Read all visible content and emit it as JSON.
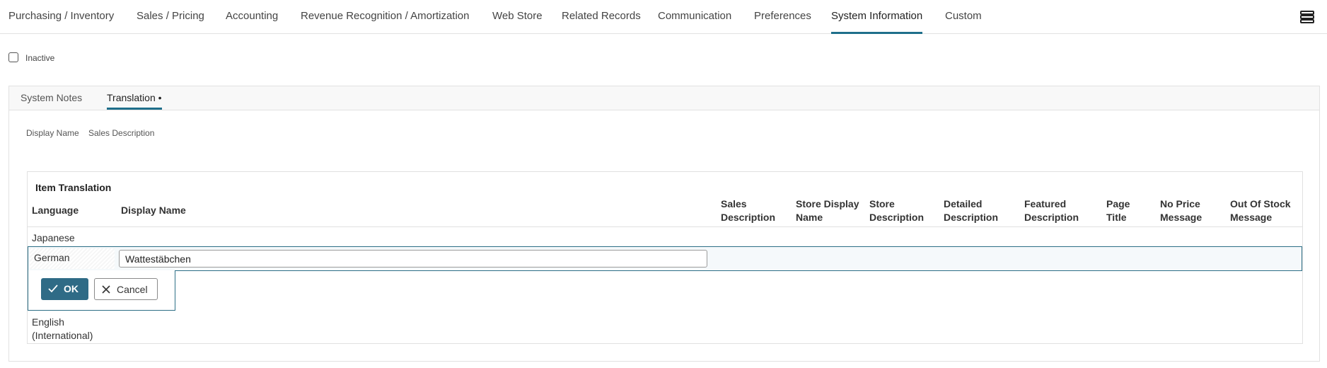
{
  "top_tabs": [
    {
      "label": "Purchasing / Inventory"
    },
    {
      "label": "Sales / Pricing"
    },
    {
      "label": "Accounting"
    },
    {
      "label": "Revenue Recognition / Amortization"
    },
    {
      "label": "Web Store"
    },
    {
      "label": "Related Records"
    },
    {
      "label": "Communication"
    },
    {
      "label": "Preferences"
    },
    {
      "label": "System Information",
      "active": true
    },
    {
      "label": "Custom"
    }
  ],
  "icons": {
    "menu": "hamburger-menu-icon",
    "ok": "checkmark-icon",
    "cancel": "x-icon"
  },
  "inactive_label": "Inactive",
  "subtabs": [
    {
      "label": "System Notes"
    },
    {
      "label": "Translation •",
      "active": true
    }
  ],
  "field_links": [
    "Display Name",
    "Sales Description"
  ],
  "grid": {
    "title": "Item Translation",
    "columns": {
      "language": "Language",
      "display_name": "Display Name",
      "sales_description": [
        "Sales",
        "Description"
      ],
      "store_display_name": [
        "Store Display",
        "Name"
      ],
      "store_description": [
        "Store",
        "Description"
      ],
      "detailed_description": [
        "Detailed",
        "Description"
      ],
      "featured_description": [
        "Featured",
        "Description"
      ],
      "page_title": [
        "Page",
        "Title"
      ],
      "no_price_message": [
        "No Price",
        "Message"
      ],
      "out_of_stock_message": [
        "Out Of Stock",
        "Message"
      ]
    },
    "rows": {
      "japanese": "Japanese",
      "german": "German",
      "english": [
        "English",
        "(International)"
      ]
    },
    "edit": {
      "display_name_value": "Wattestäbchen",
      "ok_label": "OK",
      "cancel_label": "Cancel"
    }
  },
  "colors": {
    "accent": "#1f6f8b",
    "ok_button": "#2f6b86"
  }
}
